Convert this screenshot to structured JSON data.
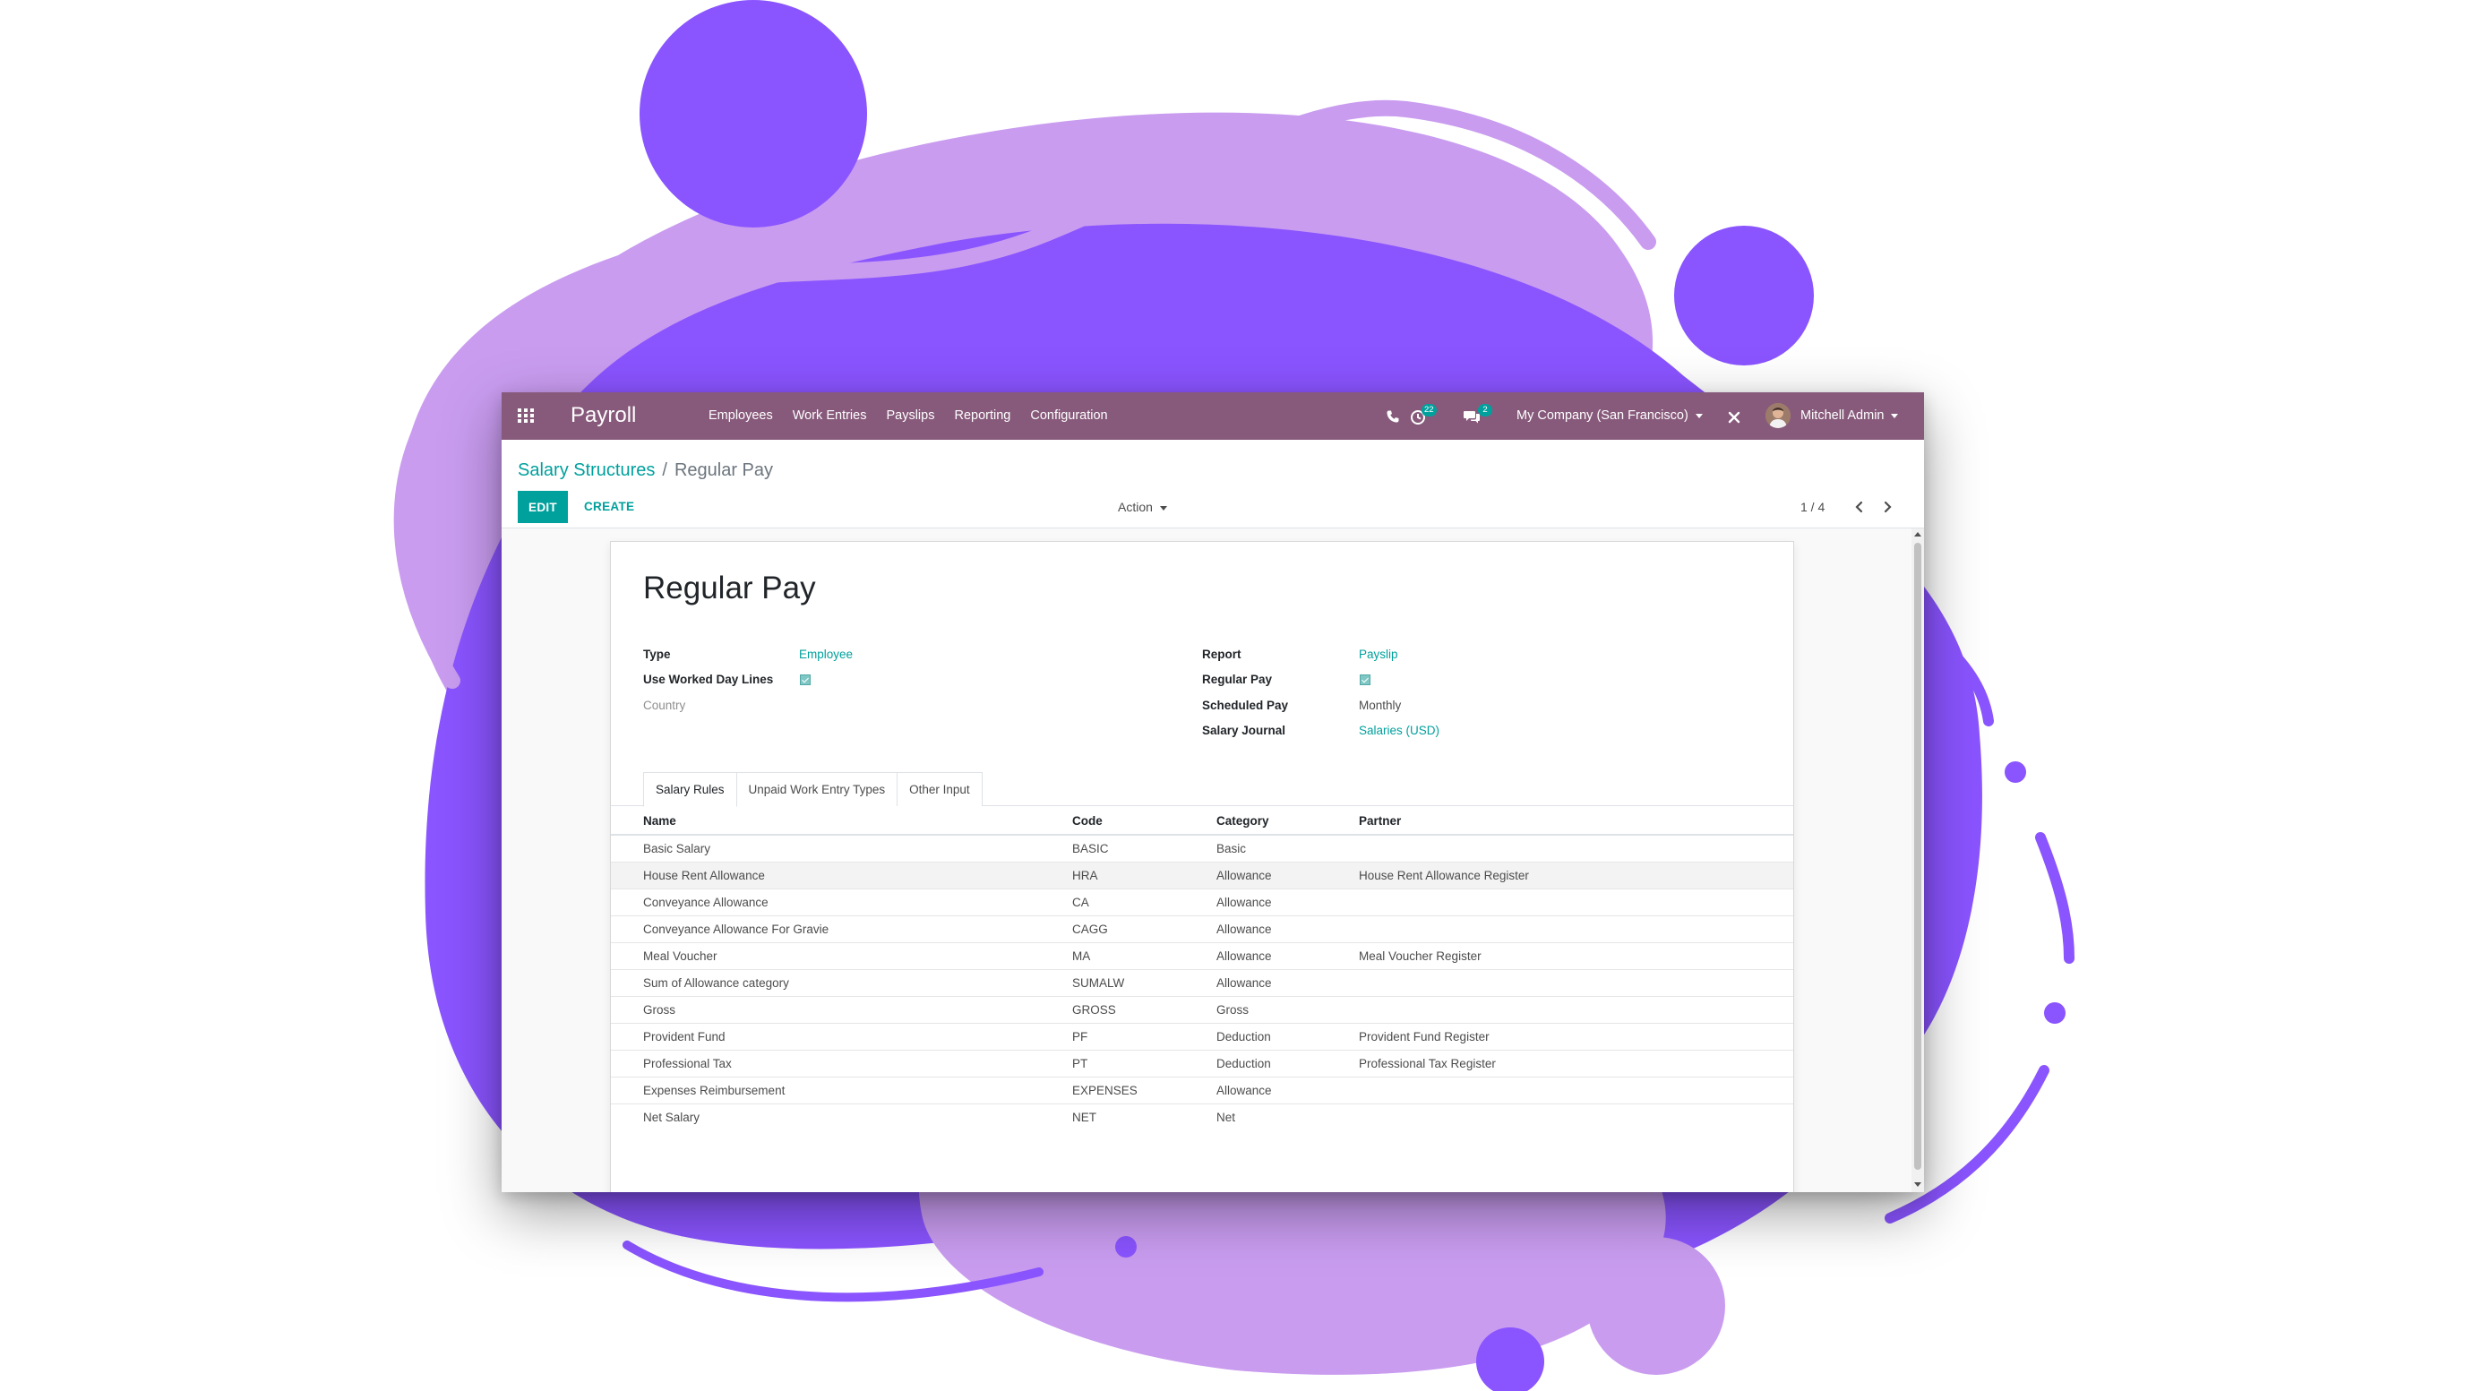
{
  "navbar": {
    "brand": "Payroll",
    "menu": [
      "Employees",
      "Work Entries",
      "Payslips",
      "Reporting",
      "Configuration"
    ],
    "activity_count": "22",
    "message_count": "2",
    "company": "My Company (San Francisco)",
    "user": "Mitchell Admin",
    "icons": [
      "apps-grid-icon",
      "phone-icon",
      "clock-icon",
      "chat-icon",
      "close-icon"
    ]
  },
  "breadcrumb": {
    "parent": "Salary Structures",
    "separator": "/",
    "current": "Regular Pay"
  },
  "buttons": {
    "edit": "EDIT",
    "create": "CREATE",
    "action": "Action"
  },
  "pager": {
    "value": "1 / 4"
  },
  "record": {
    "title": "Regular Pay",
    "left_fields": [
      {
        "label": "Type",
        "value": "Employee",
        "kind": "link"
      },
      {
        "label": "Use Worked Day Lines",
        "value": true,
        "kind": "checkbox"
      },
      {
        "label": "Country",
        "value": "",
        "kind": "empty"
      }
    ],
    "right_fields": [
      {
        "label": "Report",
        "value": "Payslip",
        "kind": "link"
      },
      {
        "label": "Regular Pay",
        "value": true,
        "kind": "checkbox"
      },
      {
        "label": "Scheduled Pay",
        "value": "Monthly",
        "kind": "text"
      },
      {
        "label": "Salary Journal",
        "value": "Salaries (USD)",
        "kind": "link"
      }
    ]
  },
  "tabs": [
    "Salary Rules",
    "Unpaid Work Entry Types",
    "Other Input"
  ],
  "rules_table": {
    "columns": [
      "Name",
      "Code",
      "Category",
      "Partner"
    ],
    "rows": [
      [
        "Basic Salary",
        "BASIC",
        "Basic",
        ""
      ],
      [
        "House Rent Allowance",
        "HRA",
        "Allowance",
        "House Rent Allowance Register"
      ],
      [
        "Conveyance Allowance",
        "CA",
        "Allowance",
        ""
      ],
      [
        "Conveyance Allowance For Gravie",
        "CAGG",
        "Allowance",
        ""
      ],
      [
        "Meal Voucher",
        "MA",
        "Allowance",
        "Meal Voucher Register"
      ],
      [
        "Sum of Allowance category",
        "SUMALW",
        "Allowance",
        ""
      ],
      [
        "Gross",
        "GROSS",
        "Gross",
        ""
      ],
      [
        "Provident Fund",
        "PF",
        "Deduction",
        "Provident Fund Register"
      ],
      [
        "Professional Tax",
        "PT",
        "Deduction",
        "Professional Tax Register"
      ],
      [
        "Expenses Reimbursement",
        "EXPENSES",
        "Allowance",
        ""
      ],
      [
        "Net Salary",
        "NET",
        "Net",
        ""
      ]
    ]
  },
  "colors": {
    "navbar": "#875a7b",
    "primary": "#00a09d",
    "blob_dark": "#8a54ff",
    "blob_light": "#c99cf0"
  }
}
